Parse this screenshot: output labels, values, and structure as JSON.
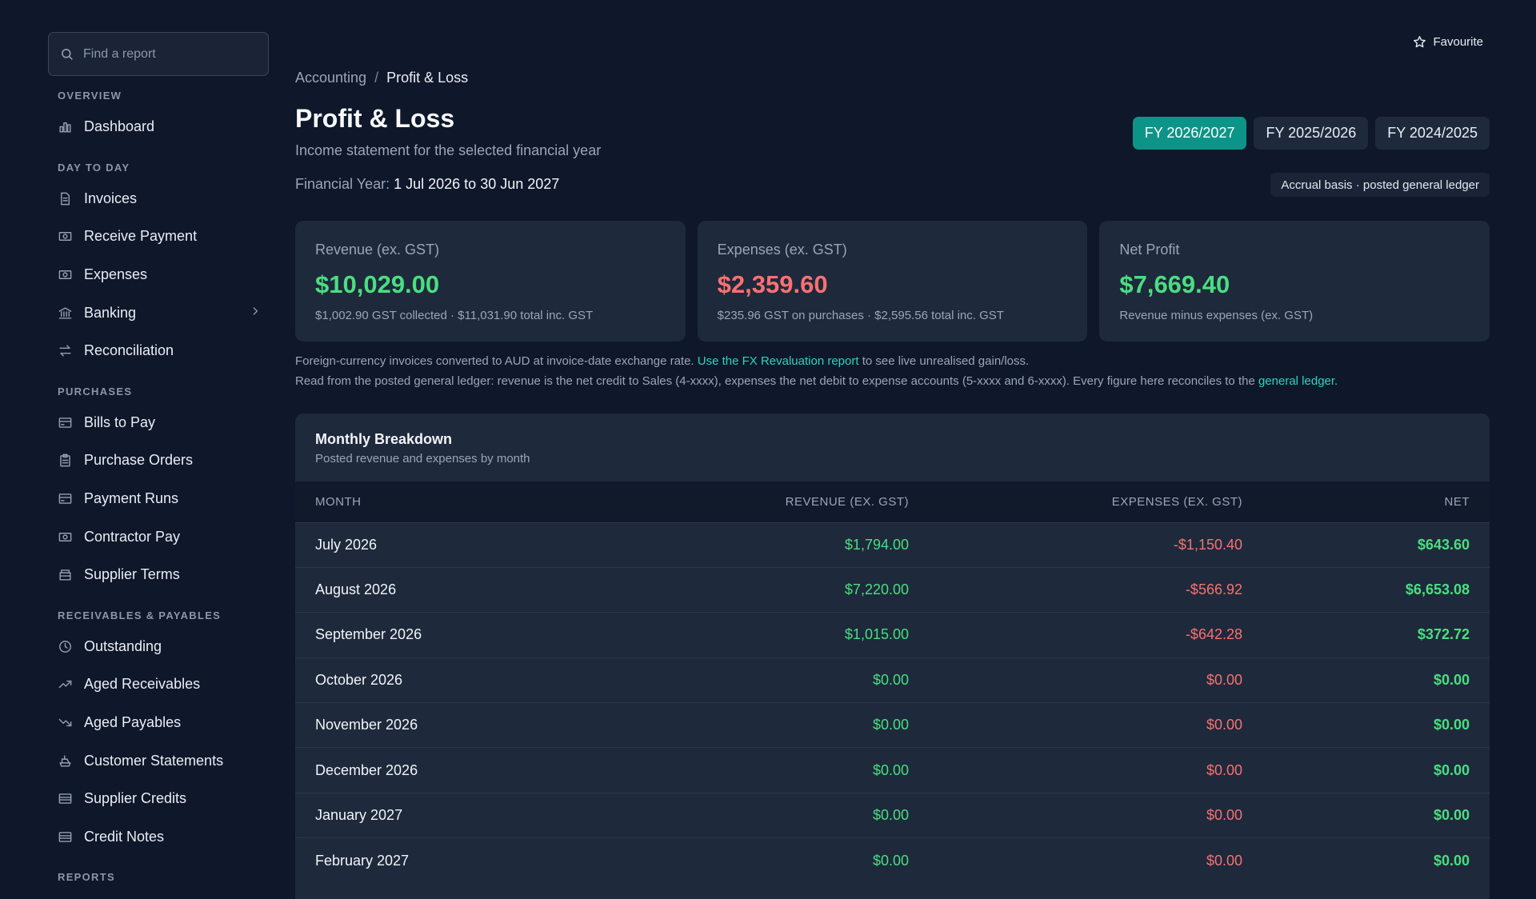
{
  "search": {
    "placeholder": "Find a report"
  },
  "sidebar": {
    "sections": [
      {
        "title": "OVERVIEW",
        "items": [
          {
            "label": "Dashboard",
            "icon": "bar-chart-icon"
          }
        ]
      },
      {
        "title": "DAY TO DAY",
        "items": [
          {
            "label": "Invoices",
            "icon": "document-icon"
          },
          {
            "label": "Receive Payment",
            "icon": "banknote-icon"
          },
          {
            "label": "Expenses",
            "icon": "banknote-icon"
          },
          {
            "label": "Banking",
            "icon": "bank-icon",
            "expandable": true
          },
          {
            "label": "Reconciliation",
            "icon": "arrows-swap-icon"
          }
        ]
      },
      {
        "title": "PURCHASES",
        "items": [
          {
            "label": "Bills to Pay",
            "icon": "credit-card-icon"
          },
          {
            "label": "Purchase Orders",
            "icon": "clipboard-icon"
          },
          {
            "label": "Payment Runs",
            "icon": "credit-card-icon"
          },
          {
            "label": "Contractor Pay",
            "icon": "banknote-icon"
          },
          {
            "label": "Supplier Terms",
            "icon": "archive-icon"
          }
        ]
      },
      {
        "title": "RECEIVABLES & PAYABLES",
        "items": [
          {
            "label": "Outstanding",
            "icon": "clock-icon"
          },
          {
            "label": "Aged Receivables",
            "icon": "trending-up-icon"
          },
          {
            "label": "Aged Payables",
            "icon": "trending-down-icon"
          },
          {
            "label": "Customer Statements",
            "icon": "ship-icon"
          },
          {
            "label": "Supplier Credits",
            "icon": "list-icon"
          },
          {
            "label": "Credit Notes",
            "icon": "list-icon"
          }
        ]
      },
      {
        "title": "REPORTS",
        "items": []
      }
    ]
  },
  "header": {
    "favourite_label": "Favourite",
    "breadcrumb": [
      "Accounting",
      "Profit & Loss"
    ],
    "breadcrumb_sep": "/",
    "title": "Profit & Loss",
    "subtitle": "Income statement for the selected financial year",
    "fy_label": "Financial Year:",
    "fy_range": "1 Jul 2026 to 30 Jun 2027",
    "fy_tabs": [
      "FY 2026/2027",
      "FY 2025/2026",
      "FY 2024/2025"
    ],
    "active_tab": 0,
    "basis_badge": "Accrual basis · posted general ledger"
  },
  "cards": [
    {
      "label": "Revenue (ex. GST)",
      "value": "$10,029.00",
      "sub": "$1,002.90 GST collected · $11,031.90 total inc. GST",
      "tone": "green"
    },
    {
      "label": "Expenses (ex. GST)",
      "value": "$2,359.60",
      "sub": "$235.96 GST on purchases · $2,595.56 total inc. GST",
      "tone": "red"
    },
    {
      "label": "Net Profit",
      "value": "$7,669.40",
      "sub": "Revenue minus expenses (ex. GST)",
      "tone": "green"
    }
  ],
  "notes": {
    "fx_text": "Foreign-currency invoices converted to AUD at invoice-date exchange rate.",
    "fx_link": "Use the FX Revaluation report",
    "fx_tail": "to see live unrealised gain/loss.",
    "ledger_text": "Read from the posted general ledger: revenue is the net credit to Sales (4-xxxx), expenses the net debit to expense accounts (5-xxxx and 6-xxxx). Every figure here reconciles to the",
    "ledger_link": "general ledger",
    "ledger_tail": "."
  },
  "breakdown": {
    "title": "Monthly Breakdown",
    "subtitle": "Posted revenue and expenses by month",
    "columns": [
      "MONTH",
      "REVENUE (EX. GST)",
      "EXPENSES (EX. GST)",
      "NET"
    ],
    "rows": [
      [
        "July 2026",
        "$1,794.00",
        "-$1,150.40",
        "$643.60"
      ],
      [
        "August 2026",
        "$7,220.00",
        "-$566.92",
        "$6,653.08"
      ],
      [
        "September 2026",
        "$1,015.00",
        "-$642.28",
        "$372.72"
      ],
      [
        "October 2026",
        "$0.00",
        "$0.00",
        "$0.00"
      ],
      [
        "November 2026",
        "$0.00",
        "$0.00",
        "$0.00"
      ],
      [
        "December 2026",
        "$0.00",
        "$0.00",
        "$0.00"
      ],
      [
        "January 2027",
        "$0.00",
        "$0.00",
        "$0.00"
      ],
      [
        "February 2027",
        "$0.00",
        "$0.00",
        "$0.00"
      ]
    ]
  },
  "colors": {
    "background": "#0f172a",
    "surface": "#1e293b",
    "accent": "#0d9488",
    "positive": "#4ade80",
    "negative": "#f87171",
    "link": "#2dd4bf"
  }
}
